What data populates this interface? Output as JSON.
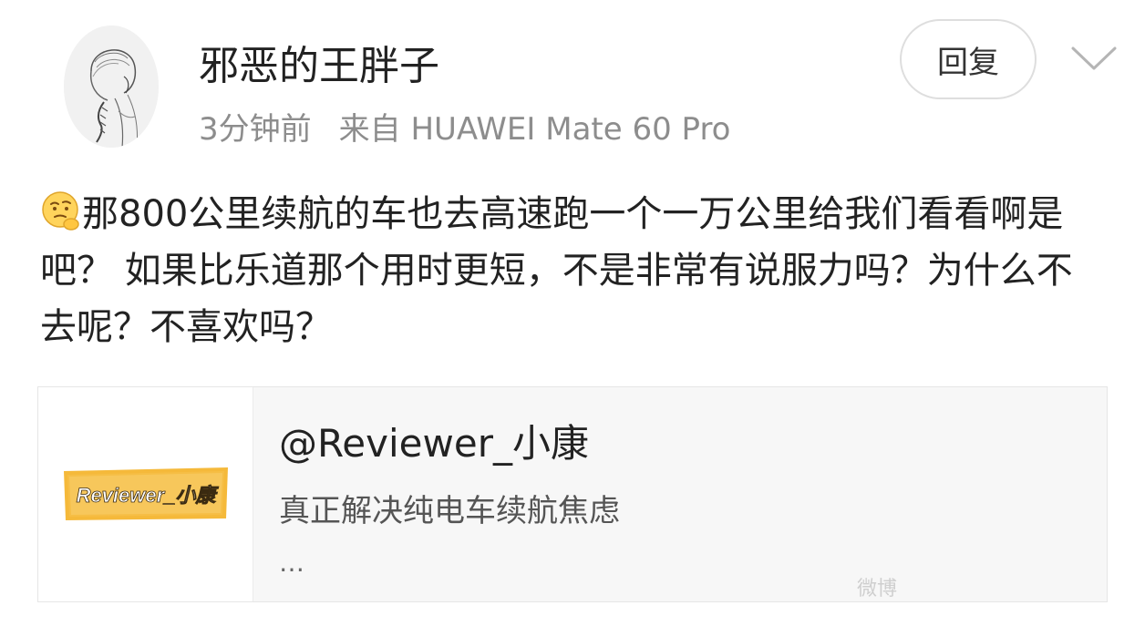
{
  "post": {
    "username": "邪恶的王胖子",
    "time": "3分钟前",
    "source": "来自 HUAWEI Mate 60 Pro",
    "reply_label": "回复",
    "emoji_icon": "thinking-face-icon",
    "text": "那800公里续航的车也去高速跑一个一万公里给我们看看啊是吧？ 如果比乐道那个用时更短，不是非常有说服力吗？为什么不去呢？不喜欢吗？"
  },
  "card": {
    "logo_text": "Reviewer_小康",
    "title": "@Reviewer_小康",
    "description": "真正解决纯电车续航焦虑",
    "more": "…"
  },
  "watermark": "微博"
}
